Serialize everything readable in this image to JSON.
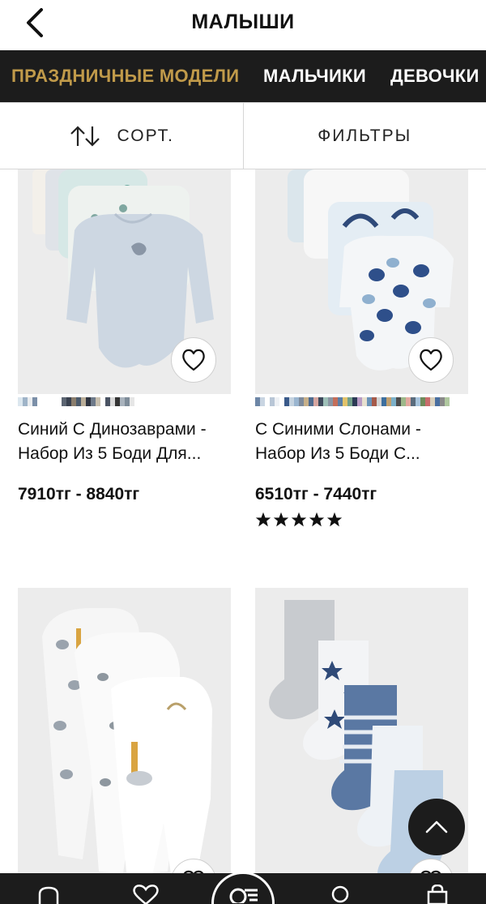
{
  "header": {
    "title": "МАЛЫШИ"
  },
  "tabs": [
    {
      "label": "ПРАЗДНИЧНЫЕ МОДЕЛИ",
      "active": true
    },
    {
      "label": "МАЛЬЧИКИ",
      "active": false
    },
    {
      "label": "ДЕВОЧКИ",
      "active": false
    }
  ],
  "toolbar": {
    "sort_label": "СОРТ.",
    "filter_label": "ФИЛЬТРЫ"
  },
  "products": [
    {
      "name": "Синий С Динозаврами - Набор Из 5 Боди Для...",
      "price": "7910тг - 8840тг",
      "rating": null
    },
    {
      "name": "С Синими Слонами - Набор Из 5 Боди С...",
      "price": "6510тг - 7440тг",
      "rating": 5
    },
    {
      "name": "",
      "price": "",
      "rating": null
    },
    {
      "name": "",
      "price": "",
      "rating": null
    }
  ],
  "colors": {
    "accent_gold": "#c09a4a",
    "dark": "#1c1c1c"
  }
}
